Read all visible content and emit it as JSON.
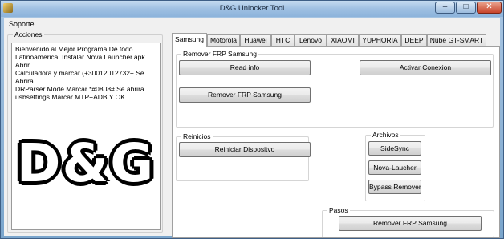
{
  "window": {
    "title": "D&G Unlocker Tool",
    "controls": {
      "minimize": "–",
      "maximize": "□",
      "close": "✕"
    }
  },
  "menu": {
    "items": [
      "Soporte"
    ]
  },
  "acciones": {
    "label": "Acciones",
    "log_lines": [
      "Bienvenido al Mejor Programa De todo",
      "Latinoamerica, Instalar Nova Launcher.apk  Abrir",
      "Calculadora y marcar (+30012012732+  Se Abrira",
      "DRParser Mode Marcar *#0808# Se abrira",
      "usbsettings Marcar MTP+ADB Y OK"
    ],
    "logo_text": "D&G"
  },
  "tabs": [
    {
      "label": "Samsung",
      "active": true
    },
    {
      "label": "Motorola",
      "active": false
    },
    {
      "label": "Huawei",
      "active": false
    },
    {
      "label": "HTC",
      "active": false
    },
    {
      "label": "Lenovo",
      "active": false
    },
    {
      "label": "XIAOMI",
      "active": false
    },
    {
      "label": "YUPHORIA",
      "active": false
    },
    {
      "label": "DEEP",
      "active": false
    },
    {
      "label": "Nube GT-SMART",
      "active": false
    }
  ],
  "samsung": {
    "frp_group": {
      "label": "Remover FRP Samsung",
      "read_info": "Read info",
      "activar_conexion": "Activar Conexion",
      "remover_frp": "Remover FRP Samsung"
    },
    "reinicios": {
      "label": "Reinicios",
      "reiniciar": "Reiniciar Dispositvo"
    },
    "archivos": {
      "label": "Archivos",
      "sidesync": "SideSync",
      "nova": "Nova-Laucher",
      "bypass": "Bypass Remover"
    },
    "pasos": {
      "label": "Pasos",
      "remover_frp": "Remover FRP Samsung"
    }
  },
  "colors": {
    "titlebar": "#9fc0e2",
    "client_bg": "#f0f0f0",
    "close_button": "#c7432a"
  }
}
